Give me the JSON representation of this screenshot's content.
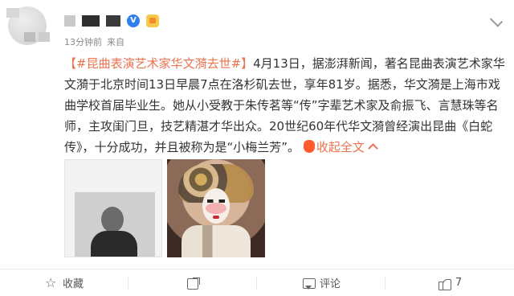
{
  "post": {
    "timestamp": "13分钟前",
    "source": "来自",
    "hashtag": "【#昆曲表演艺术家华文漪去世#】",
    "text": "4月13日，据澎湃新闻，著名昆曲表演艺术家华文漪于北京时间13日早晨7点在洛杉矶去世，享年81岁。据悉，华文漪是上海市戏曲学校首届毕业生。她从小受教于朱传茗等“传”字辈艺术家及俞振飞、言慧珠等名师，主攻闺门旦，技艺精湛才华出众。20世纪60年代华文漪曾经演出昆曲《白蛇传》，十分成功，并且被称为是“小梅兰芳”。",
    "collapse_label": "收起全文",
    "icons": {
      "verified": "verified-icon",
      "member": "crown-icon",
      "menu": "chevron-down-icon",
      "collapse_fire": "fire-icon",
      "collapse_caret": "chevron-up-icon"
    },
    "images": [
      {
        "label": "speech-photo"
      },
      {
        "label": "opera-portrait"
      }
    ]
  },
  "actions": {
    "favorite": "收藏",
    "share_icon": "share-icon",
    "comment": "评论",
    "like_count": "7"
  },
  "colors": {
    "accent": "#eb7350",
    "text": "#333333",
    "muted": "#888888"
  }
}
